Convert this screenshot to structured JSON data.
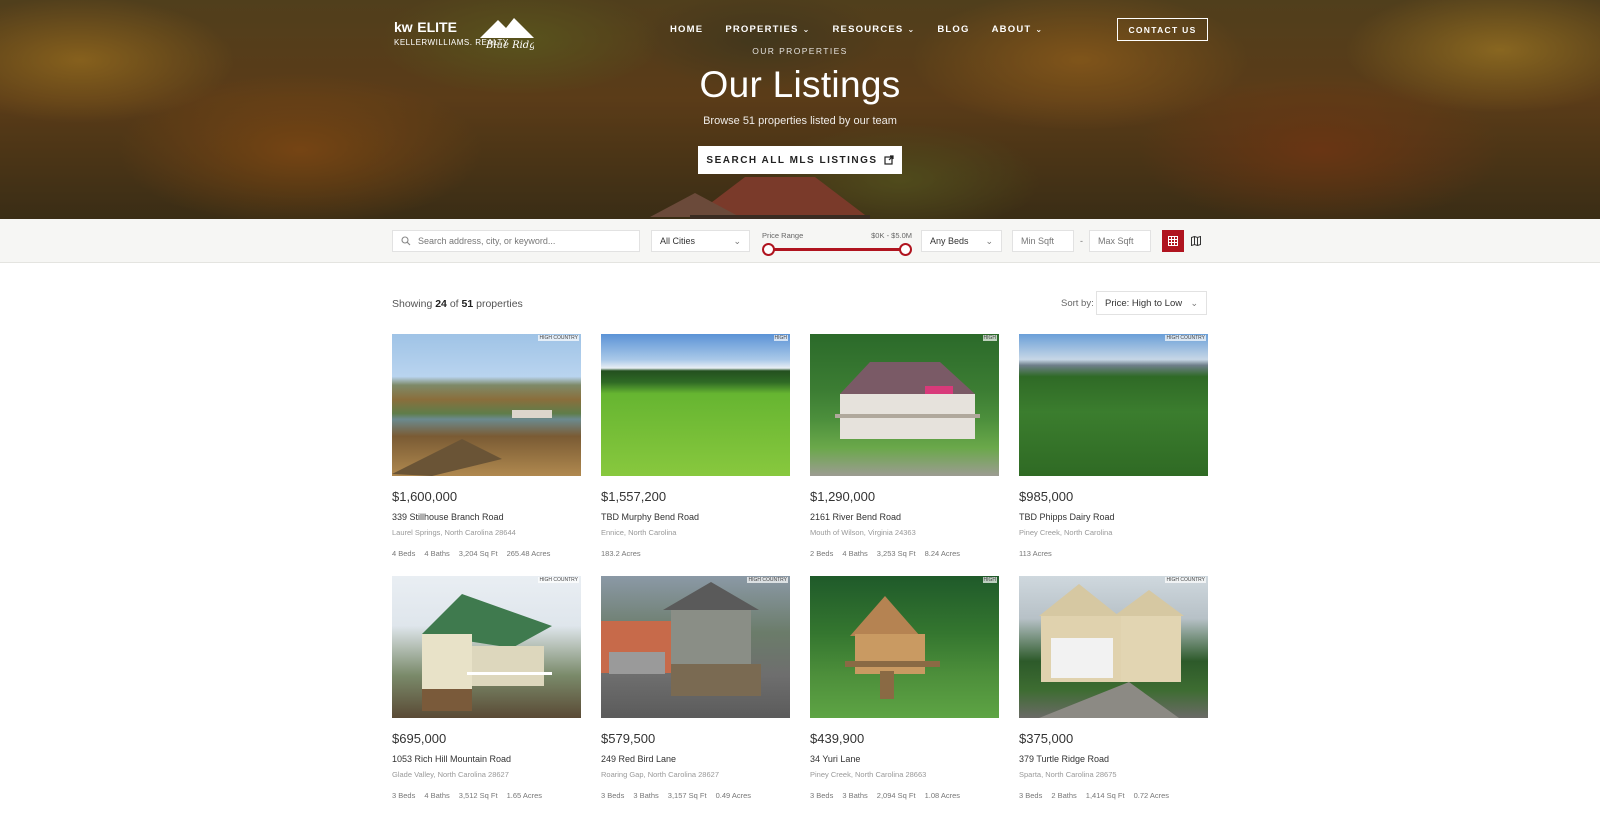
{
  "brand": {
    "logo_main": "kw",
    "logo_elite": "ELITE",
    "logo_sub": "KELLERWILLIAMS. REALTY",
    "logo_script": "Blue Ridge"
  },
  "nav": {
    "items": [
      {
        "label": "HOME",
        "has_dropdown": false
      },
      {
        "label": "PROPERTIES",
        "has_dropdown": true
      },
      {
        "label": "RESOURCES",
        "has_dropdown": true
      },
      {
        "label": "BLOG",
        "has_dropdown": false
      },
      {
        "label": "ABOUT",
        "has_dropdown": true
      }
    ],
    "contact_label": "CONTACT US"
  },
  "hero": {
    "eyebrow": "OUR PROPERTIES",
    "title": "Our Listings",
    "subtitle": "Browse 51 properties listed by our team",
    "button_label": "SEARCH ALL MLS LISTINGS"
  },
  "filters": {
    "search_placeholder": "Search address, city, or keyword...",
    "cities_value": "All Cities",
    "price_label": "Price Range",
    "price_value": "$0K - $5.0M",
    "beds_value": "Any Beds",
    "min_sqft_placeholder": "Min Sqft",
    "max_sqft_placeholder": "Max Sqft",
    "separator": "-"
  },
  "results": {
    "showing_prefix": "Showing",
    "shown": "24",
    "of_word": "of",
    "total": "51",
    "suffix": "properties",
    "sort_label": "Sort by:",
    "sort_value": "Price: High to Low"
  },
  "listings": [
    {
      "price": "$1,600,000",
      "address": "339 Stillhouse Branch Road",
      "city": "Laurel Springs, North Carolina 28644",
      "specs": [
        "4 Beds",
        "4 Baths",
        "3,204 Sq Ft",
        "265.48 Acres"
      ],
      "watermark": "HIGH COUNTRY"
    },
    {
      "price": "$1,557,200",
      "address": "TBD Murphy Bend Road",
      "city": "Ennice, North Carolina",
      "specs": [
        "183.2 Acres"
      ],
      "watermark": "HIGH"
    },
    {
      "price": "$1,290,000",
      "address": "2161 River Bend Road",
      "city": "Mouth of Wilson, Virginia 24363",
      "specs": [
        "2 Beds",
        "4 Baths",
        "3,253 Sq Ft",
        "8.24 Acres"
      ],
      "watermark": "HIGH"
    },
    {
      "price": "$985,000",
      "address": "TBD Phipps Dairy Road",
      "city": "Piney Creek, North Carolina",
      "specs": [
        "113 Acres"
      ],
      "watermark": "HIGH COUNTRY"
    },
    {
      "price": "$695,000",
      "address": "1053 Rich Hill Mountain Road",
      "city": "Glade Valley, North Carolina 28627",
      "specs": [
        "3 Beds",
        "4 Baths",
        "3,512 Sq Ft",
        "1.65 Acres"
      ],
      "watermark": "HIGH COUNTRY"
    },
    {
      "price": "$579,500",
      "address": "249 Red Bird Lane",
      "city": "Roaring Gap, North Carolina 28627",
      "specs": [
        "3 Beds",
        "3 Baths",
        "3,157 Sq Ft",
        "0.49 Acres"
      ],
      "watermark": "HIGH COUNTRY"
    },
    {
      "price": "$439,900",
      "address": "34 Yuri Lane",
      "city": "Piney Creek, North Carolina 28663",
      "specs": [
        "3 Beds",
        "3 Baths",
        "2,094 Sq Ft",
        "1.08 Acres"
      ],
      "watermark": "HIGH"
    },
    {
      "price": "$375,000",
      "address": "379 Turtle Ridge Road",
      "city": "Sparta, North Carolina 28675",
      "specs": [
        "3 Beds",
        "2 Baths",
        "1,414 Sq Ft",
        "0.72 Acres"
      ],
      "watermark": "HIGH COUNTRY"
    }
  ],
  "icons": {
    "search": "search-icon",
    "chevron": "chevron-down-icon",
    "external": "external-link-icon",
    "grid": "grid-view-icon",
    "map": "map-view-icon"
  },
  "colors": {
    "accent": "#b0141f"
  }
}
